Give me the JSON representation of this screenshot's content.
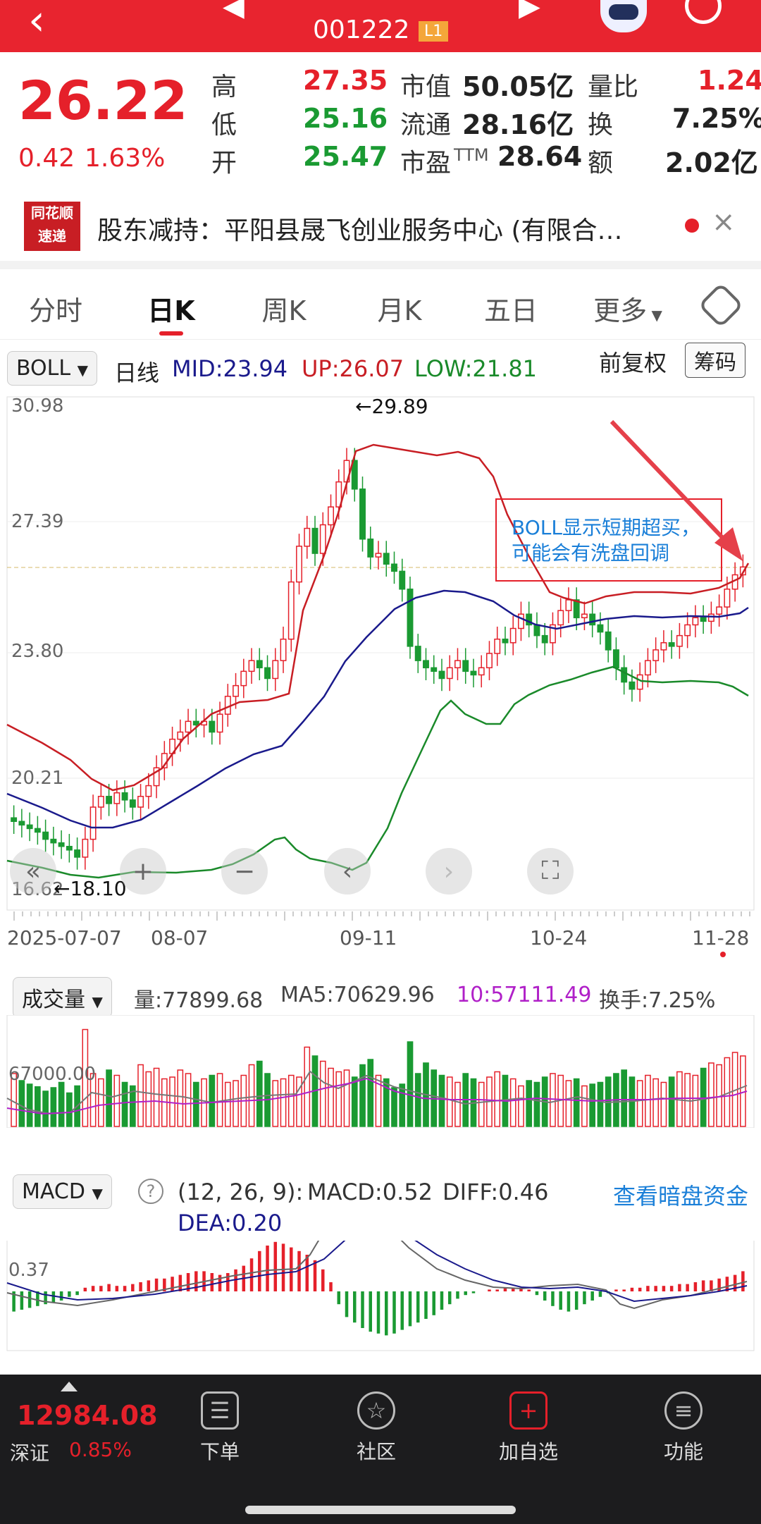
{
  "header": {
    "code": "001222",
    "level": "L1"
  },
  "quote": {
    "price": "26.22",
    "change": "0.42",
    "change_pct": "1.63%",
    "high_label": "高",
    "high": "27.35",
    "low_label": "低",
    "low": "25.16",
    "open_label": "开",
    "open": "25.47",
    "mcap_label": "市值",
    "mcap": "50.05亿",
    "float_label": "流通",
    "float": "28.16亿",
    "pe_label": "市盈",
    "pe_sup": "TTM",
    "pe": "28.64",
    "vr_label": "量比",
    "vr": "1.24",
    "turn_label": "换",
    "turn": "7.25%",
    "amt_label": "额",
    "amt": "2.02亿"
  },
  "news": {
    "logo_top": "同花顺",
    "logo_bottom": "速递",
    "text": "股东减持：平阳县晟飞创业服务中心 (有限合…"
  },
  "tabs": [
    "分时",
    "日K",
    "周K",
    "月K",
    "五日",
    "更多"
  ],
  "active_tab": "日K",
  "boll": {
    "indicator": "BOLL",
    "period": "日线",
    "mid": "MID:23.94",
    "up": "UP:26.07",
    "low": "LOW:21.81",
    "adjust": "前复权",
    "chip": "筹码"
  },
  "kchart": {
    "y_labels": [
      "30.98",
      "27.39",
      "23.80",
      "20.21",
      "16.62"
    ],
    "high_mark": "←29.89",
    "low_mark": "←18.10",
    "annotation": "BOLL显示短期超买，可能会有洗盘回调",
    "x_labels": [
      "2025-07-07",
      "08-07",
      "09-11",
      "10-24",
      "11-28"
    ]
  },
  "volume": {
    "indicator": "成交量",
    "vol": "量:77899.68",
    "ma5": "MA5:70629.96",
    "ma10": "10:57111.49",
    "turnover": "换手:7.25%",
    "y_label": "67000.00"
  },
  "macd": {
    "indicator": "MACD",
    "params": "(12, 26, 9):",
    "macd": "MACD:0.52",
    "diff": "DIFF:0.46",
    "dea": "DEA:0.20",
    "link": "查看暗盘资金",
    "y_label": "0.37"
  },
  "bottom": {
    "index_value": "12984.08",
    "index_name": "深证",
    "index_pct": "0.85%",
    "nav": [
      "下单",
      "社区",
      "加自选",
      "功能"
    ]
  },
  "colors": {
    "up": "#e5202a",
    "down": "#1a9a32",
    "brand": "#e8242f",
    "mid_line": "#1a1a8c",
    "ma10": "#b020c8"
  },
  "chart_data": {
    "type": "candlestick",
    "indicator": "BOLL",
    "period": "daily",
    "x_range": [
      "2025-07-07",
      "2025-11-28"
    ],
    "y_range": [
      16.62,
      30.98
    ],
    "period_high": 29.89,
    "period_low": 18.1,
    "last_close": 26.22,
    "boll_mid": 23.94,
    "boll_up": 26.07,
    "boll_low": 21.81
  }
}
